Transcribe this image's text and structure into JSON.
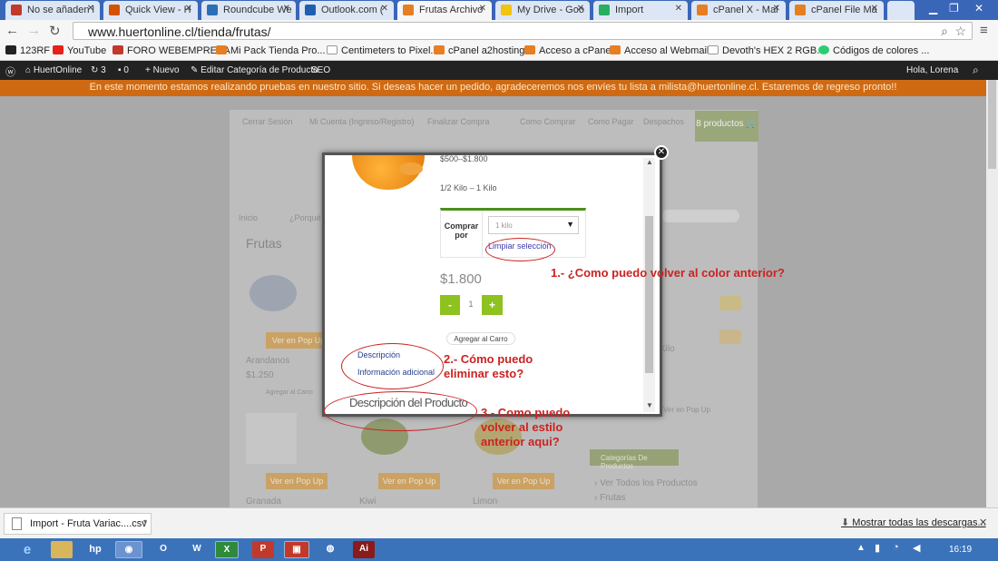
{
  "browser": {
    "tabs": [
      {
        "label": "No se añaden l",
        "color": "#c0392b"
      },
      {
        "label": "Quick View - H",
        "color": "#d35400"
      },
      {
        "label": "Roundcube We",
        "color": "#2c6fb5"
      },
      {
        "label": "Outlook.com (",
        "color": "#1f5fb0"
      },
      {
        "label": "Frutas Archivo",
        "color": "#e67e22"
      },
      {
        "label": "My Drive - Goo",
        "color": "#f1c40f"
      },
      {
        "label": "Import",
        "color": "#27ae60"
      },
      {
        "label": "cPanel X - Mai",
        "color": "#e67e22"
      },
      {
        "label": "cPanel File Ma",
        "color": "#e67e22"
      }
    ],
    "url": "www.huertonline.cl/tienda/frutas/",
    "bookmarks": [
      {
        "label": "123RF",
        "color": "#222"
      },
      {
        "label": "YouTube",
        "color": "#e62117"
      },
      {
        "label": "FORO WEBEMPRESA",
        "color": "#c0392b"
      },
      {
        "label": "Mi Pack Tienda Pro...",
        "color": "#e67e22"
      },
      {
        "label": "Centimeters to Pixel...",
        "color": "#fff"
      },
      {
        "label": "cPanel a2hosting",
        "color": "#e67e22"
      },
      {
        "label": "Acceso a cPanel",
        "color": "#e67e22"
      },
      {
        "label": "Acceso al Webmail",
        "color": "#e67e22"
      },
      {
        "label": "Devoth's HEX 2 RGB...",
        "color": "#fff"
      },
      {
        "label": "Códigos de colores ...",
        "color": "#2ecc71"
      }
    ]
  },
  "adminbar": {
    "site": "HuertOnline",
    "updates": "3",
    "comments": "0",
    "new": "Nuevo",
    "edit": "Editar Categoría de Producto",
    "seo": "SEO",
    "greeting": "Hola, Lorena"
  },
  "notice": "En este momento estamos realizando pruebas en nuestro sitio. Si deseas hacer un pedido, agradeceremos nos envíes tu lista a milista@huertonline.cl. Estaremos de regreso pronto!!",
  "site": {
    "topnav": [
      "Cerrar Sesión",
      "Mi Cuenta (Ingreso/Registro)",
      "Finalizar Compra",
      "Como Comprar",
      "Como Pagar",
      "Despachos"
    ],
    "cart": "8 productos",
    "menu_left": "Inicio",
    "menu_2": "¿Porqué H",
    "category_title": "Frutas",
    "popup_button": "Ver en Pop Up",
    "products": [
      {
        "name": "Arandanos",
        "price": "$1.250"
      },
      {
        "name": "Granada",
        "price": ""
      },
      {
        "name": "Kiwi",
        "price": ""
      },
      {
        "name": "Limon",
        "price": ""
      }
    ],
    "add_cart_small": "Agregar al Carro",
    "right_item": "Kilo",
    "right_button": "Ver en Pop Up",
    "categories_title": "Categorías De Productos",
    "categories": [
      "Ver Todos los Productos",
      "Frutas"
    ]
  },
  "modal": {
    "price_range": "$500–$1.800",
    "variation_note": "1/2 Kilo – 1 Kilo",
    "buy_by_label": "Comprar por",
    "select_value": "1 kilo",
    "clear_link": "Limpiar selección",
    "price": "$1.800",
    "minus": "-",
    "qty": "1",
    "plus": "+",
    "add_to_cart": "Agregar al Carro",
    "tabs": [
      "Descripción",
      "Información adicional"
    ],
    "description_heading": "Descripción del Producto"
  },
  "annotations": {
    "q1": "1.- ¿Como puedo volver al color anterior?",
    "q2": "2.- Cómo puedo eliminar esto?",
    "q3": "3.- Como puedo volver al estilo anterior aqui?"
  },
  "downloads": {
    "file": "Import - Fruta Variac....csv",
    "show_all": "Mostrar todas las descargas..."
  },
  "taskbar": {
    "clock": "16:19"
  }
}
